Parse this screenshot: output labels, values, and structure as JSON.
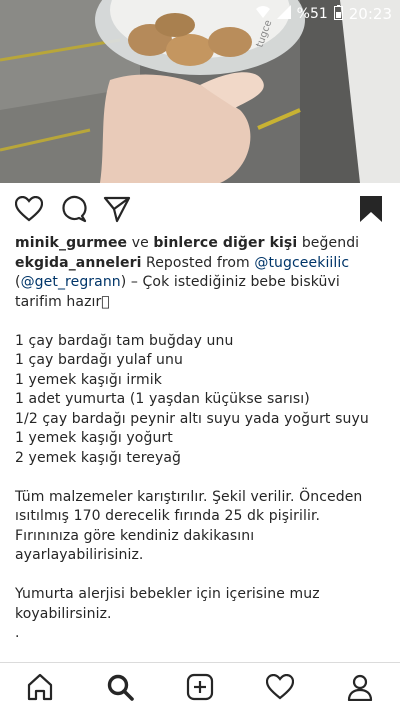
{
  "status": {
    "battery": "%51",
    "time": "20:23"
  },
  "post_image": {
    "alt_text": "tugce"
  },
  "likes": {
    "first_user": "minik_gurmee",
    "connector": " ve ",
    "others": "binlerce diğer kişi",
    "suffix": " beğendi"
  },
  "caption": {
    "username": "ekgida_anneleri",
    "reposted_from": " Reposted from ",
    "mention1": "@tugceekiilic",
    "open_paren": "(",
    "mention2": "@get_regrann",
    "intro": ") – Çok istediğiniz bebe bisküvi tarifim hazır",
    "ingredients": [
      "1 çay bardağı tam buğday unu",
      "1 çay bardağı yulaf unu",
      "1 yemek kaşığı irmik",
      "1 adet yumurta (1 yaşdan küçükse sarısı)",
      "1/2 çay bardağı peynir altı suyu yada yoğurt suyu",
      "1 yemek kaşığı yoğurt",
      "2 yemek kaşığı tereyağ"
    ],
    "instructions": "Tüm malzemeler karıştırılır. Şekil verilir. Önceden ısıtılmış 170 derecelik fırında 25 dk pişirilir. Fırınınıza göre kendiniz dakikasını ayarlayabilirisiniz.",
    "allergy_note": "Yumurta alerjisi bebekler için içerisine muz koyabilirsiniz.",
    "dot": "."
  },
  "icons": {
    "like": "heart-icon",
    "comment": "comment-icon",
    "share": "direct-share-icon",
    "save": "bookmark-icon",
    "nav": [
      "home-icon",
      "search-icon",
      "new-post-icon",
      "activity-heart-icon",
      "profile-icon"
    ]
  },
  "colors": {
    "link": "#003569",
    "text": "#262626"
  }
}
